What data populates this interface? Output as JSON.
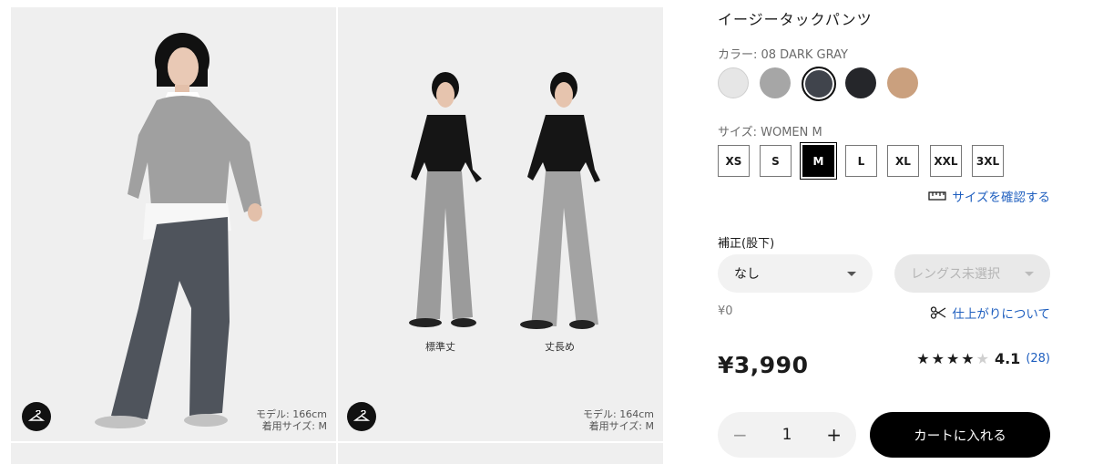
{
  "product": {
    "title": "イージータックパンツ",
    "color_label": "カラー: 08 DARK GRAY",
    "colors": [
      {
        "name": "off-white",
        "hex": "#e6e6e6"
      },
      {
        "name": "gray",
        "hex": "#a6a6a6"
      },
      {
        "name": "dark-gray",
        "hex": "#40444c",
        "selected": true
      },
      {
        "name": "black",
        "hex": "#25262a"
      },
      {
        "name": "beige",
        "hex": "#caa07e"
      }
    ],
    "size_label": "サイズ: WOMEN M",
    "sizes": [
      "XS",
      "S",
      "M",
      "L",
      "XL",
      "XXL",
      "3XL"
    ],
    "selected_size": "M",
    "size_guide_link": "サイズを確認する",
    "alteration_label": "補正(股下)",
    "alteration_select": "なし",
    "length_select": "レングス未選択",
    "alteration_price": "¥0",
    "finish_link": "仕上がりについて",
    "price": "¥3,990",
    "rating": {
      "stars": 4,
      "max": 5,
      "value": "4.1",
      "count": "(28)"
    },
    "quantity": "1",
    "quantity_minus": "−",
    "quantity_plus": "+",
    "cart_button": "カートに入れる"
  },
  "images": {
    "left": {
      "model_height": "モデル: 166cm",
      "model_size": "着用サイズ: M"
    },
    "right": {
      "model_height": "モデル: 164cm",
      "model_size": "着用サイズ: M",
      "caption_standard": "標準丈",
      "caption_long": "丈長め"
    }
  },
  "colors": {
    "link": "#1f5fbf",
    "accent": "#000000"
  }
}
